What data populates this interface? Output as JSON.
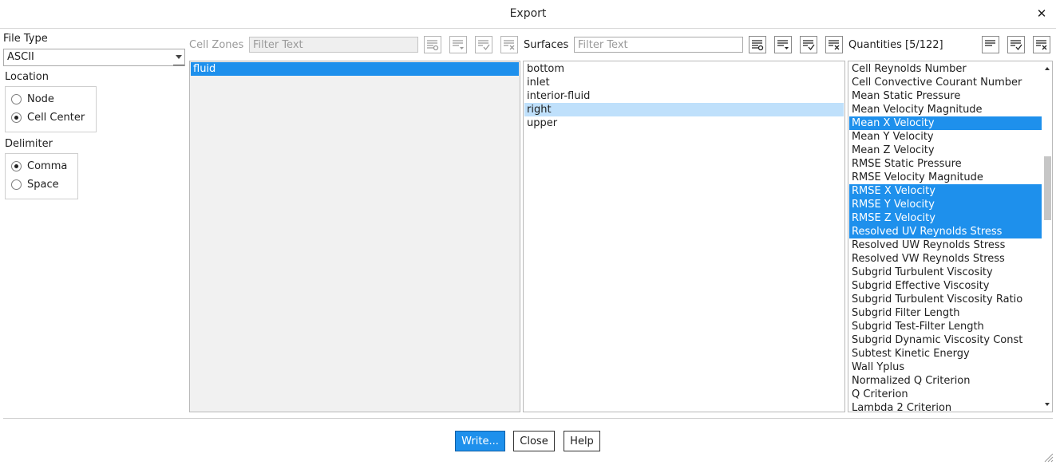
{
  "window": {
    "title": "Export"
  },
  "file_type": {
    "label": "File Type",
    "value": "ASCII"
  },
  "location": {
    "label": "Location",
    "options": [
      {
        "label": "Node",
        "selected": false
      },
      {
        "label": "Cell Center",
        "selected": true
      }
    ]
  },
  "delimiter": {
    "label": "Delimiter",
    "options": [
      {
        "label": "Comma",
        "selected": true
      },
      {
        "label": "Space",
        "selected": false
      }
    ]
  },
  "cell_zones": {
    "label": "Cell Zones",
    "filter_placeholder": "Filter Text",
    "items": [
      {
        "label": "fluid",
        "state": "selected"
      }
    ]
  },
  "surfaces": {
    "label": "Surfaces",
    "filter_placeholder": "Filter Text",
    "items": [
      {
        "label": "bottom",
        "state": ""
      },
      {
        "label": "inlet",
        "state": ""
      },
      {
        "label": "interior-fluid",
        "state": ""
      },
      {
        "label": "right",
        "state": "hover"
      },
      {
        "label": "upper",
        "state": ""
      }
    ]
  },
  "quantities": {
    "label": "Quantities [5/122]",
    "items": [
      {
        "label": "Cell Reynolds Number",
        "state": ""
      },
      {
        "label": "Cell Convective Courant Number",
        "state": ""
      },
      {
        "label": "Mean Static Pressure",
        "state": ""
      },
      {
        "label": "Mean Velocity Magnitude",
        "state": ""
      },
      {
        "label": "Mean X Velocity",
        "state": "selected"
      },
      {
        "label": "Mean Y Velocity",
        "state": ""
      },
      {
        "label": "Mean Z Velocity",
        "state": ""
      },
      {
        "label": "RMSE Static Pressure",
        "state": ""
      },
      {
        "label": "RMSE Velocity Magnitude",
        "state": ""
      },
      {
        "label": "RMSE X Velocity",
        "state": "selected"
      },
      {
        "label": "RMSE Y Velocity",
        "state": "selected"
      },
      {
        "label": "RMSE Z Velocity",
        "state": "selected"
      },
      {
        "label": "Resolved UV Reynolds Stress",
        "state": "selected"
      },
      {
        "label": "Resolved UW Reynolds Stress",
        "state": ""
      },
      {
        "label": "Resolved VW Reynolds Stress",
        "state": ""
      },
      {
        "label": "Subgrid Turbulent Viscosity",
        "state": ""
      },
      {
        "label": "Subgrid Effective Viscosity",
        "state": ""
      },
      {
        "label": "Subgrid Turbulent Viscosity Ratio",
        "state": ""
      },
      {
        "label": "Subgrid Filter Length",
        "state": ""
      },
      {
        "label": "Subgrid Test-Filter Length",
        "state": ""
      },
      {
        "label": "Subgrid Dynamic Viscosity Const",
        "state": ""
      },
      {
        "label": "Subtest Kinetic Energy",
        "state": ""
      },
      {
        "label": "Wall Yplus",
        "state": ""
      },
      {
        "label": "Normalized Q Criterion",
        "state": ""
      },
      {
        "label": "Q Criterion",
        "state": ""
      },
      {
        "label": "Lambda 2 Criterion",
        "state": ""
      }
    ]
  },
  "buttons": {
    "write": "Write...",
    "close": "Close",
    "help": "Help"
  },
  "colors": {
    "selection": "#1e90ec",
    "hover": "#bfe0fb",
    "list_grey": "#f1f1f1"
  },
  "icons": {
    "close": "close-icon",
    "new_list": "new-list-icon",
    "list_options": "list-options-icon",
    "select_all": "select-all-icon",
    "deselect_all": "deselect-all-icon",
    "resize": "resize-grip-icon"
  }
}
